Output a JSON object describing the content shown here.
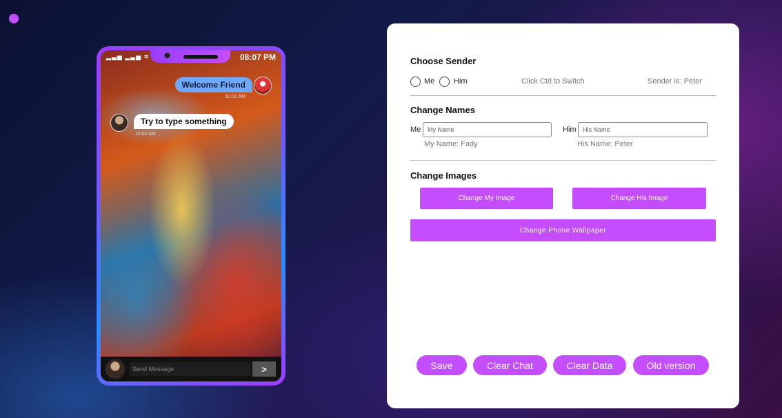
{
  "phone": {
    "status_icons": "▂▃▅ ▂▃▅ ≋",
    "time": "08:07 PM",
    "messages": [
      {
        "sender": "me",
        "text": "Welcome Friend",
        "time": "10:00 AM"
      },
      {
        "sender": "him",
        "text": "Try to type something",
        "time": "10:02 AM"
      }
    ],
    "input_placeholder": "Send Message",
    "send_label": ">"
  },
  "panel": {
    "choose_sender": {
      "title": "Choose Sender",
      "option_me": "Me",
      "option_him": "Him",
      "hint": "Click Ctrl to Switch",
      "current": "Sender is: Peter"
    },
    "change_names": {
      "title": "Change Names",
      "me_label": "Me",
      "me_placeholder": "My Name",
      "me_current": "My Name: Fady",
      "him_label": "Him",
      "him_placeholder": "His Name",
      "him_current": "His Name: Peter"
    },
    "change_images": {
      "title": "Change Images",
      "my_image_button": "Change My Image",
      "his_image_button": "Change His Image",
      "wallpaper_button": "Change Phone Wallpaper"
    },
    "actions": {
      "save": "Save",
      "clear_chat": "Clear Chat",
      "clear_data": "Clear Data",
      "old_version": "Old version"
    }
  },
  "colors": {
    "accent": "#c44dff",
    "bubble_me": "#6fa8ff",
    "bubble_him": "#ffffff"
  }
}
